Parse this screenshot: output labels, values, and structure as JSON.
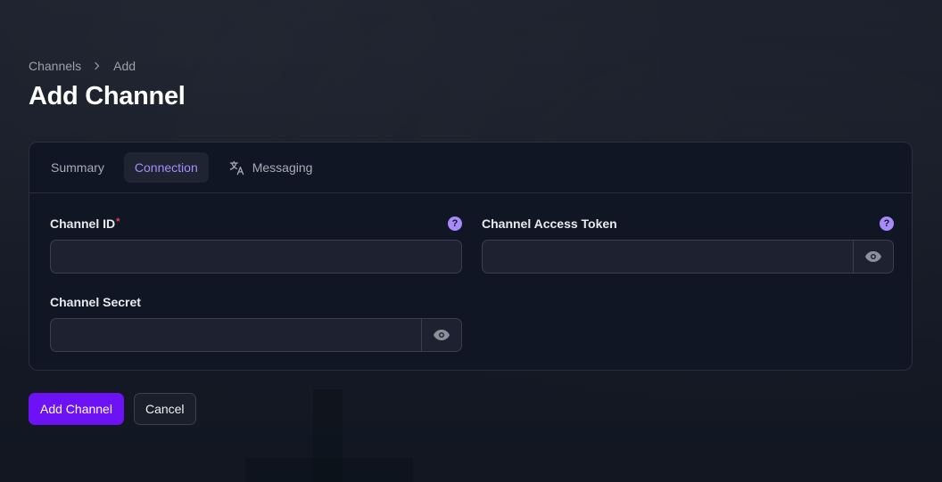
{
  "breadcrumb": {
    "items": [
      "Channels",
      "Add"
    ]
  },
  "page": {
    "title": "Add Channel"
  },
  "tabs": [
    {
      "label": "Summary",
      "active": false
    },
    {
      "label": "Connection",
      "active": true
    },
    {
      "label": "Messaging",
      "active": false,
      "icon": "translate-icon"
    }
  ],
  "form": {
    "channel_id": {
      "label": "Channel ID",
      "required_mark": "*",
      "value": "",
      "help_icon": "question-circle-icon"
    },
    "channel_access_token": {
      "label": "Channel Access Token",
      "value": "",
      "help_icon": "question-circle-icon",
      "toggle_icon": "eye-icon"
    },
    "channel_secret": {
      "label": "Channel Secret",
      "value": "",
      "toggle_icon": "eye-icon"
    }
  },
  "actions": {
    "submit_label": "Add Channel",
    "cancel_label": "Cancel"
  },
  "colors": {
    "accent": "#a78bfa",
    "primary_button": "#6d12f5",
    "required": "#ef4444",
    "background": "#161b26",
    "card": "#111624"
  }
}
